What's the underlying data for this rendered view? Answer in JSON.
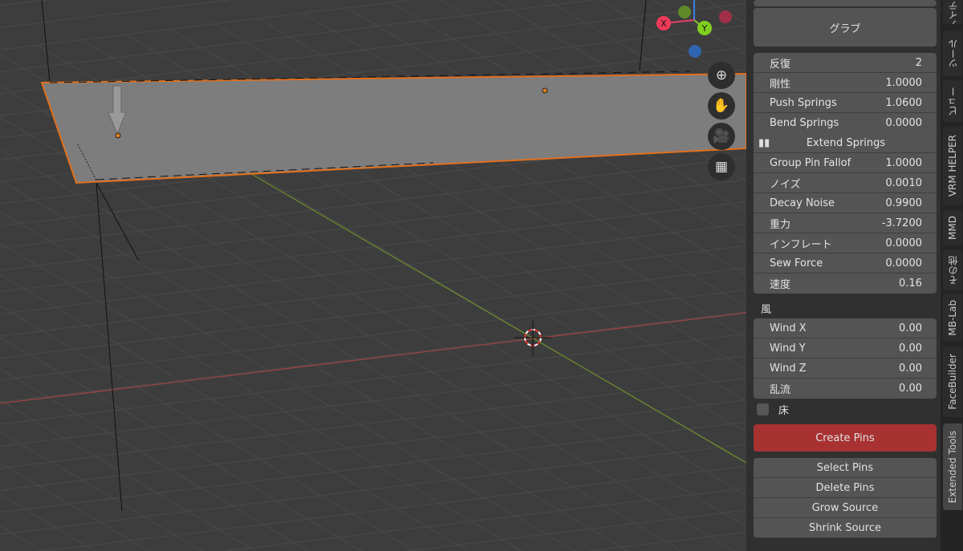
{
  "gizmo": {
    "x": "X",
    "y": "Y"
  },
  "nav_icons": [
    "zoom-icon",
    "hand-pan-icon",
    "camera-icon",
    "grid-perspective-icon"
  ],
  "panel": {
    "grab_label": "グラブ",
    "rows": [
      {
        "label": "反復",
        "value": "2"
      },
      {
        "label": "剛性",
        "value": "1.0000"
      },
      {
        "label": "Push Springs",
        "value": "1.0600"
      },
      {
        "label": "Bend Springs",
        "value": "0.0000"
      }
    ],
    "extend_springs": "Extend Springs",
    "rows2": [
      {
        "label": "Group Pin Fallof",
        "value": "1.0000"
      },
      {
        "label": "ノイズ",
        "value": "0.0010"
      },
      {
        "label": "Decay Noise",
        "value": "0.9900"
      },
      {
        "label": "重力",
        "value": "-3.7200"
      },
      {
        "label": "インフレート",
        "value": "0.0000"
      },
      {
        "label": "Sew Force",
        "value": "0.0000"
      },
      {
        "label": "速度",
        "value": "0.16"
      }
    ],
    "wind_heading": "風",
    "wind": [
      {
        "label": "Wind X",
        "value": "0.00"
      },
      {
        "label": "Wind Y",
        "value": "0.00"
      },
      {
        "label": "Wind Z",
        "value": "0.00"
      },
      {
        "label": "乱流",
        "value": "0.00"
      }
    ],
    "floor_label": "床",
    "floor_checked": false,
    "create_pins": "Create Pins",
    "accent": "#a83232",
    "buttons": [
      "Select Pins",
      "Delete Pins",
      "Grow Source",
      "Shrink Source"
    ]
  },
  "tabs": [
    "アイテム",
    "ツール",
    "ビュー",
    "VRM HELPER",
    "MMD",
    "その他",
    "MB-Lab",
    "FaceBuilder",
    "Extended Tools"
  ],
  "active_tab": "Extended Tools"
}
